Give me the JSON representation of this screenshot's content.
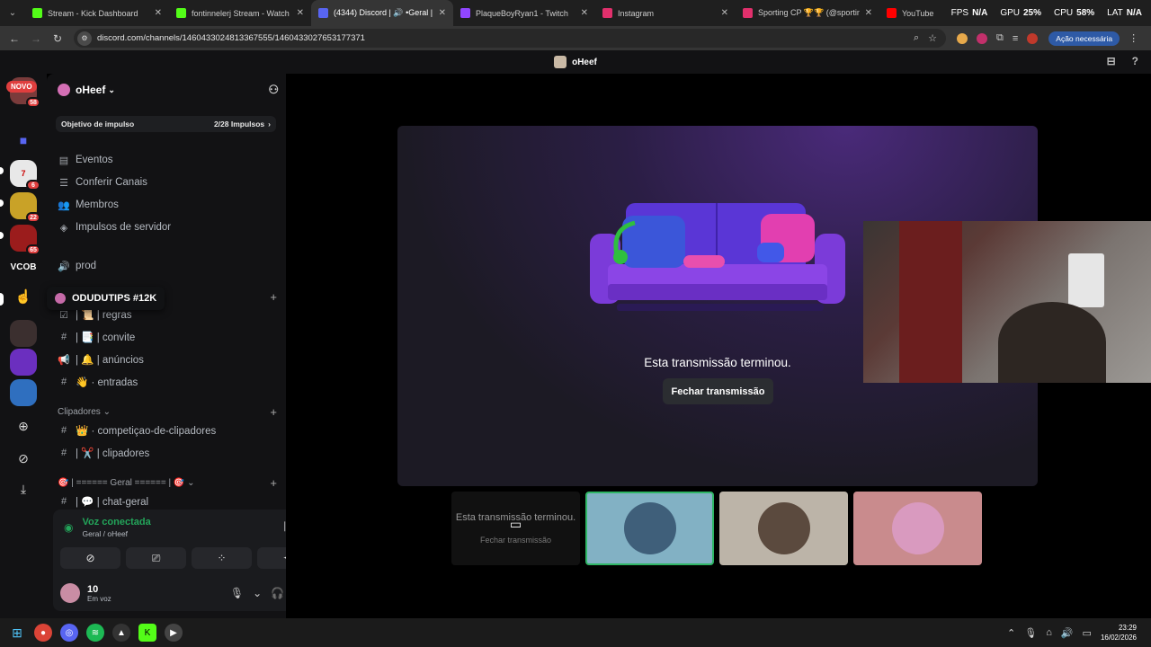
{
  "browser": {
    "tabs": [
      {
        "title": "Stream - Kick Dashboard",
        "fav_color": "#53fc18",
        "active": false
      },
      {
        "title": "fontinnelerj Stream - Watch Live",
        "fav_color": "#53fc18",
        "active": false
      },
      {
        "title": "(4344) Discord | 🔊 •Geral |",
        "fav_color": "#5865f2",
        "active": true
      },
      {
        "title": "PlaqueBoyRyan1 - Twitch",
        "fav_color": "#9146ff",
        "active": false
      },
      {
        "title": "Instagram",
        "fav_color": "#e1306c",
        "active": false
      },
      {
        "title": "Sporting CP 🏆🏆 (@sporting",
        "fav_color": "#e1306c",
        "active": false
      },
      {
        "title": "YouTube",
        "fav_color": "#ff0000",
        "active": false
      }
    ],
    "url": "discord.com/channels/1460433024813367555/1460433027653177371",
    "update_label": "Ação necessária",
    "perf": {
      "fps_label": "FPS",
      "fps": "N/A",
      "gpu_label": "GPU",
      "gpu": "25%",
      "cpu_label": "CPU",
      "cpu": "58%",
      "lat_label": "LAT",
      "lat": "N/A"
    }
  },
  "discord_top": {
    "title": "oHeef"
  },
  "rail": {
    "novo": "NOVO",
    "badges": [
      "58",
      "6",
      "22",
      "65"
    ],
    "vcob": "VCOB"
  },
  "server": {
    "name": "oHeef",
    "boost_label": "Objetivo de impulso",
    "boost_count": "2/28 Impulsos",
    "menu": [
      {
        "icon": "▤",
        "label": "Eventos"
      },
      {
        "icon": "☰",
        "label": "Conferir Canais"
      },
      {
        "icon": "👥",
        "label": "Membros"
      },
      {
        "icon": "◈",
        "label": "Impulsos de servidor"
      }
    ],
    "prod_label": "prod",
    "tooltip": "ODUDUTIPS #12K",
    "channels_a": [
      {
        "icon": "☑",
        "label": "| 📜 | regras"
      },
      {
        "icon": "#",
        "label": "| 📑 | convite"
      },
      {
        "icon": "📢",
        "label": "| 🔔 | anúncios"
      },
      {
        "icon": "#",
        "label": "👋 · entradas"
      }
    ],
    "cat_clip": "Clipadores ⌄",
    "channels_b": [
      {
        "icon": "#",
        "label": "👑 · competiçao-de-clipadores"
      },
      {
        "icon": "#",
        "label": "| ✂️ | clipadores"
      }
    ],
    "cat_geral": "🎯 | ====== Geral ====== | 🎯 ⌄",
    "channels_c": [
      {
        "icon": "#",
        "label": "| 💬 | chat-geral"
      }
    ]
  },
  "voice": {
    "title": "Voz conectada",
    "subtitle": "Geral / oHeef"
  },
  "user": {
    "name": "10",
    "status": "Em voz"
  },
  "stage": {
    "ended_text": "Esta transmissão terminou.",
    "close_label": "Fechar transmissão",
    "thumb_text": "Esta transmissão terminou.",
    "thumb_btn": "Fechar transmissão"
  },
  "taskbar": {
    "time": "23:29",
    "date": "16/02/2026"
  }
}
